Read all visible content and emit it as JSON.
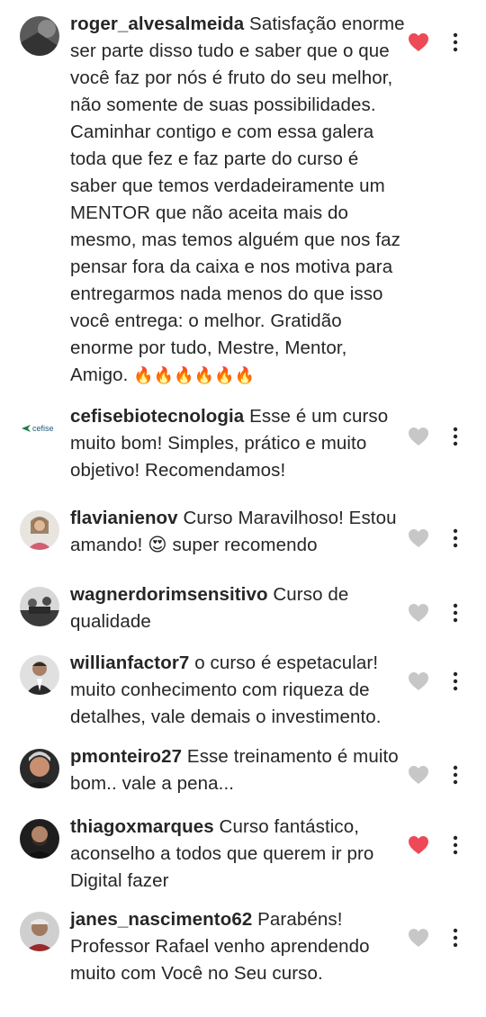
{
  "colors": {
    "liked_heart": "#ed4956",
    "unliked_heart": "#c7c7c7",
    "text": "#262626"
  },
  "comments": [
    {
      "username": "roger_alvesalmeida",
      "text": " Satisfação enorme ser parte disso tudo e saber que o que você faz por nós é fruto do seu melhor, não somente de suas possibilidades. Caminhar contigo e com essa galera toda que fez e faz parte do curso é saber que temos verdadeiramente um MENTOR que não aceita mais do mesmo, mas temos alguém que nos faz pensar fora da caixa e nos motiva para entregarmos nada menos do que isso você entrega: o melhor. Gratidão enorme por tudo, Mestre, Mentor, Amigo.",
      "emoji": "🔥🔥🔥🔥🔥🔥",
      "liked": true
    },
    {
      "username": "cefisebiotecnologia",
      "text": " Esse é um curso muito bom! Simples, prático e muito objetivo! Recomendamos!",
      "avatar_text": "cefise",
      "liked": false
    },
    {
      "username": "flavianienov",
      "text": " Curso Maravilhoso! Estou amando! 😍 super recomendo",
      "liked": false
    },
    {
      "username": "wagnerdorimsensitivo",
      "text": " Curso de qualidade",
      "liked": false
    },
    {
      "username": "willianfactor7",
      "text": " o curso é espetacular! muito conhecimento com riqueza de detalhes, vale demais o investimento.",
      "liked": false
    },
    {
      "username": "pmonteiro27",
      "text": " Esse treinamento é muito bom.. vale a pena...",
      "liked": false
    },
    {
      "username": "thiagoxmarques",
      "text": " Curso fantástico, aconselho a todos que querem ir pro Digital fazer",
      "liked": true
    },
    {
      "username": "janes_nascimento62",
      "text": " Parabéns! Professor Rafael venho aprendendo muito com Você no Seu curso.",
      "liked": false
    }
  ]
}
